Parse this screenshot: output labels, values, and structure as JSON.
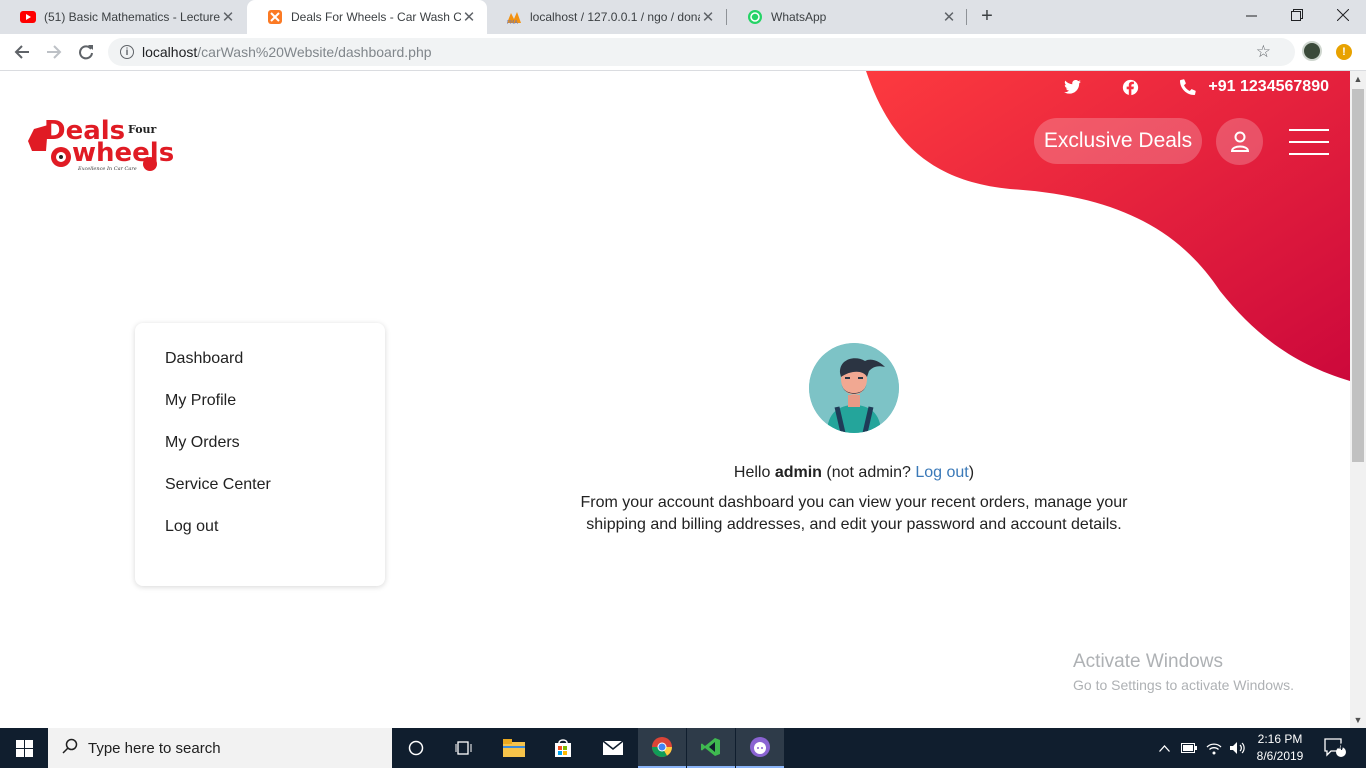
{
  "browser": {
    "tabs": [
      {
        "title": "(51) Basic Mathematics - Lecture",
        "favicon": "youtube-icon"
      },
      {
        "title": "Deals For Wheels - Car Wash Cer",
        "favicon": "xampp-icon",
        "active": true
      },
      {
        "title": "localhost / 127.0.0.1 / ngo / dona",
        "favicon": "phpmyadmin-icon"
      },
      {
        "title": "WhatsApp",
        "favicon": "whatsapp-icon"
      }
    ],
    "address": {
      "host": "localhost",
      "path": "/carWash%20Website/dashboard.php"
    }
  },
  "site": {
    "phone": "+91 1234567890",
    "exclusive_deals": "Exclusive Deals",
    "logo": {
      "line1": "Deals",
      "line2": "Four",
      "line3": "wheels",
      "tagline": "Excellence In Car Care"
    },
    "accent_color": "#f5323f",
    "accent_dark": "#cf0a3c"
  },
  "sidebar": {
    "items": [
      {
        "label": "Dashboard"
      },
      {
        "label": "My Profile"
      },
      {
        "label": "My Orders"
      },
      {
        "label": "Service Center"
      },
      {
        "label": "Log out"
      }
    ]
  },
  "main": {
    "hello_prefix": "Hello",
    "username": "admin",
    "not_prefix": "(not admin?",
    "logout_link": "Log out",
    "not_suffix": ")",
    "description": "From your account dashboard you can view your recent orders, manage your shipping and billing addresses, and edit your password and account details."
  },
  "watermark": {
    "title": "Activate Windows",
    "subtitle": "Go to Settings to activate Windows."
  },
  "taskbar": {
    "search_placeholder": "Type here to search",
    "time": "2:16 PM",
    "date": "8/6/2019",
    "notification_count": "4"
  }
}
